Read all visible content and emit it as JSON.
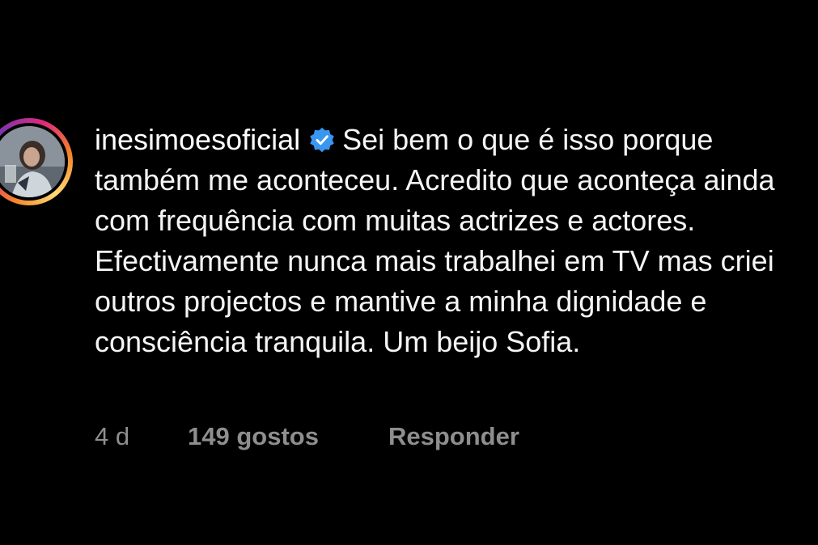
{
  "comment": {
    "username": "inesimoesoficial",
    "verified_icon": "verified-badge-icon",
    "text": "Sei bem o que é isso porque também me aconteceu. Acredito que aconteça ainda com frequência com muitas actrizes e actores. Efectivamente nunca mais trabalhei em TV mas criei outros projectos e mantive a minha dignidade e consciência tranquila. Um beijo Sofia."
  },
  "meta": {
    "time": "4 d",
    "likes": "149 gostos",
    "reply": "Responder"
  },
  "colors": {
    "background": "#000000",
    "text": "#f5f5f5",
    "secondary": "#8e8e8e",
    "verified": "#3897f0"
  }
}
